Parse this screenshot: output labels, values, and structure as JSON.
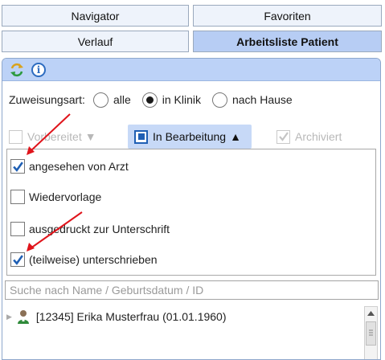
{
  "tabs": {
    "navigator": "Navigator",
    "favoriten": "Favoriten",
    "verlauf": "Verlauf",
    "arbeitsliste": "Arbeitsliste Patient"
  },
  "toolbar": {
    "icons": [
      "refresh-icon",
      "info-icon"
    ],
    "info_glyph": "i"
  },
  "assignment": {
    "label": "Zuweisungsart:",
    "options": [
      "alle",
      "in Klinik",
      "nach Hause"
    ],
    "selected": "in Klinik"
  },
  "status_filters": {
    "vorbereitet": "Vorbereitet",
    "in_bearbeitung": "In Bearbeitung",
    "archiviert": "Archiviert",
    "arrow_down": "▼",
    "arrow_up": "▲"
  },
  "substatus": {
    "items": [
      {
        "label": "angesehen von Arzt",
        "checked": true
      },
      {
        "label": "Wiedervorlage",
        "checked": false
      },
      {
        "label": "ausgedruckt zur Unterschrift",
        "checked": false
      },
      {
        "label": "(teilweise) unterschrieben",
        "checked": true
      }
    ]
  },
  "search": {
    "placeholder": "Suche nach Name / Geburtsdatum / ID",
    "value": ""
  },
  "patients": [
    {
      "label": "[12345] Erika Musterfrau (01.01.1960)"
    }
  ],
  "colors": {
    "accent": "#b7cdf4",
    "panel_header": "#bcd2f7",
    "checkmark": "#1f5fb4",
    "annotation_arrow": "#e0141b"
  }
}
